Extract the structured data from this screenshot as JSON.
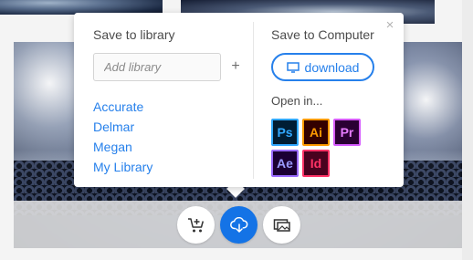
{
  "save_to_library": {
    "title": "Save to library",
    "add_placeholder": "Add library",
    "add_plus": "+",
    "libraries": [
      "Accurate",
      "Delmar",
      "Megan",
      "My Library"
    ]
  },
  "save_to_computer": {
    "title": "Save to Computer",
    "download_label": "download",
    "open_in_label": "Open in...",
    "apps": [
      {
        "abbr": "Ps",
        "bg": "#001d34",
        "fg": "#31a8ff",
        "border": "#31a8ff"
      },
      {
        "abbr": "Ai",
        "bg": "#330000",
        "fg": "#ff9a00",
        "border": "#ff9a00"
      },
      {
        "abbr": "Pr",
        "bg": "#2a0034",
        "fg": "#e77cff",
        "border": "#d65cff"
      },
      {
        "abbr": "Ae",
        "bg": "#1b0033",
        "fg": "#9a9aff",
        "border": "#9a6bff"
      },
      {
        "abbr": "Id",
        "bg": "#49021f",
        "fg": "#ff3366",
        "border": "#ff3366"
      }
    ]
  },
  "close_glyph": "×",
  "colors": {
    "accent": "#2680eb",
    "primary_button": "#1473e6"
  }
}
